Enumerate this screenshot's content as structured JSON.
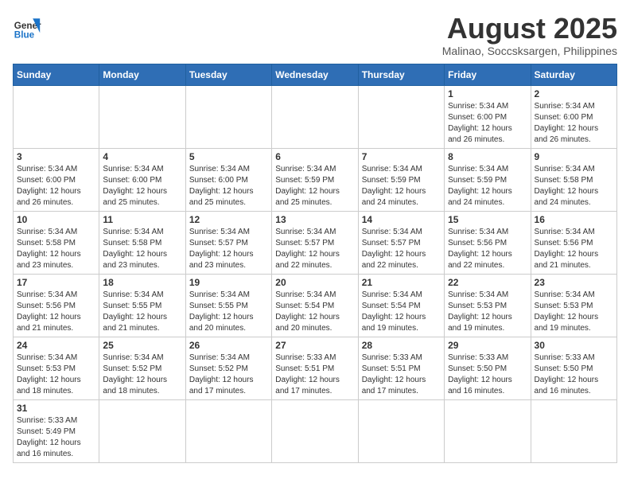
{
  "header": {
    "logo_general": "General",
    "logo_blue": "Blue",
    "title": "August 2025",
    "subtitle": "Malinao, Soccsksargen, Philippines"
  },
  "weekdays": [
    "Sunday",
    "Monday",
    "Tuesday",
    "Wednesday",
    "Thursday",
    "Friday",
    "Saturday"
  ],
  "weeks": [
    [
      {
        "day": "",
        "info": ""
      },
      {
        "day": "",
        "info": ""
      },
      {
        "day": "",
        "info": ""
      },
      {
        "day": "",
        "info": ""
      },
      {
        "day": "",
        "info": ""
      },
      {
        "day": "1",
        "info": "Sunrise: 5:34 AM\nSunset: 6:00 PM\nDaylight: 12 hours and 26 minutes."
      },
      {
        "day": "2",
        "info": "Sunrise: 5:34 AM\nSunset: 6:00 PM\nDaylight: 12 hours and 26 minutes."
      }
    ],
    [
      {
        "day": "3",
        "info": "Sunrise: 5:34 AM\nSunset: 6:00 PM\nDaylight: 12 hours and 26 minutes."
      },
      {
        "day": "4",
        "info": "Sunrise: 5:34 AM\nSunset: 6:00 PM\nDaylight: 12 hours and 25 minutes."
      },
      {
        "day": "5",
        "info": "Sunrise: 5:34 AM\nSunset: 6:00 PM\nDaylight: 12 hours and 25 minutes."
      },
      {
        "day": "6",
        "info": "Sunrise: 5:34 AM\nSunset: 5:59 PM\nDaylight: 12 hours and 25 minutes."
      },
      {
        "day": "7",
        "info": "Sunrise: 5:34 AM\nSunset: 5:59 PM\nDaylight: 12 hours and 24 minutes."
      },
      {
        "day": "8",
        "info": "Sunrise: 5:34 AM\nSunset: 5:59 PM\nDaylight: 12 hours and 24 minutes."
      },
      {
        "day": "9",
        "info": "Sunrise: 5:34 AM\nSunset: 5:58 PM\nDaylight: 12 hours and 24 minutes."
      }
    ],
    [
      {
        "day": "10",
        "info": "Sunrise: 5:34 AM\nSunset: 5:58 PM\nDaylight: 12 hours and 23 minutes."
      },
      {
        "day": "11",
        "info": "Sunrise: 5:34 AM\nSunset: 5:58 PM\nDaylight: 12 hours and 23 minutes."
      },
      {
        "day": "12",
        "info": "Sunrise: 5:34 AM\nSunset: 5:57 PM\nDaylight: 12 hours and 23 minutes."
      },
      {
        "day": "13",
        "info": "Sunrise: 5:34 AM\nSunset: 5:57 PM\nDaylight: 12 hours and 22 minutes."
      },
      {
        "day": "14",
        "info": "Sunrise: 5:34 AM\nSunset: 5:57 PM\nDaylight: 12 hours and 22 minutes."
      },
      {
        "day": "15",
        "info": "Sunrise: 5:34 AM\nSunset: 5:56 PM\nDaylight: 12 hours and 22 minutes."
      },
      {
        "day": "16",
        "info": "Sunrise: 5:34 AM\nSunset: 5:56 PM\nDaylight: 12 hours and 21 minutes."
      }
    ],
    [
      {
        "day": "17",
        "info": "Sunrise: 5:34 AM\nSunset: 5:56 PM\nDaylight: 12 hours and 21 minutes."
      },
      {
        "day": "18",
        "info": "Sunrise: 5:34 AM\nSunset: 5:55 PM\nDaylight: 12 hours and 21 minutes."
      },
      {
        "day": "19",
        "info": "Sunrise: 5:34 AM\nSunset: 5:55 PM\nDaylight: 12 hours and 20 minutes."
      },
      {
        "day": "20",
        "info": "Sunrise: 5:34 AM\nSunset: 5:54 PM\nDaylight: 12 hours and 20 minutes."
      },
      {
        "day": "21",
        "info": "Sunrise: 5:34 AM\nSunset: 5:54 PM\nDaylight: 12 hours and 19 minutes."
      },
      {
        "day": "22",
        "info": "Sunrise: 5:34 AM\nSunset: 5:53 PM\nDaylight: 12 hours and 19 minutes."
      },
      {
        "day": "23",
        "info": "Sunrise: 5:34 AM\nSunset: 5:53 PM\nDaylight: 12 hours and 19 minutes."
      }
    ],
    [
      {
        "day": "24",
        "info": "Sunrise: 5:34 AM\nSunset: 5:53 PM\nDaylight: 12 hours and 18 minutes."
      },
      {
        "day": "25",
        "info": "Sunrise: 5:34 AM\nSunset: 5:52 PM\nDaylight: 12 hours and 18 minutes."
      },
      {
        "day": "26",
        "info": "Sunrise: 5:34 AM\nSunset: 5:52 PM\nDaylight: 12 hours and 17 minutes."
      },
      {
        "day": "27",
        "info": "Sunrise: 5:33 AM\nSunset: 5:51 PM\nDaylight: 12 hours and 17 minutes."
      },
      {
        "day": "28",
        "info": "Sunrise: 5:33 AM\nSunset: 5:51 PM\nDaylight: 12 hours and 17 minutes."
      },
      {
        "day": "29",
        "info": "Sunrise: 5:33 AM\nSunset: 5:50 PM\nDaylight: 12 hours and 16 minutes."
      },
      {
        "day": "30",
        "info": "Sunrise: 5:33 AM\nSunset: 5:50 PM\nDaylight: 12 hours and 16 minutes."
      }
    ],
    [
      {
        "day": "31",
        "info": "Sunrise: 5:33 AM\nSunset: 5:49 PM\nDaylight: 12 hours and 16 minutes."
      },
      {
        "day": "",
        "info": ""
      },
      {
        "day": "",
        "info": ""
      },
      {
        "day": "",
        "info": ""
      },
      {
        "day": "",
        "info": ""
      },
      {
        "day": "",
        "info": ""
      },
      {
        "day": "",
        "info": ""
      }
    ]
  ]
}
